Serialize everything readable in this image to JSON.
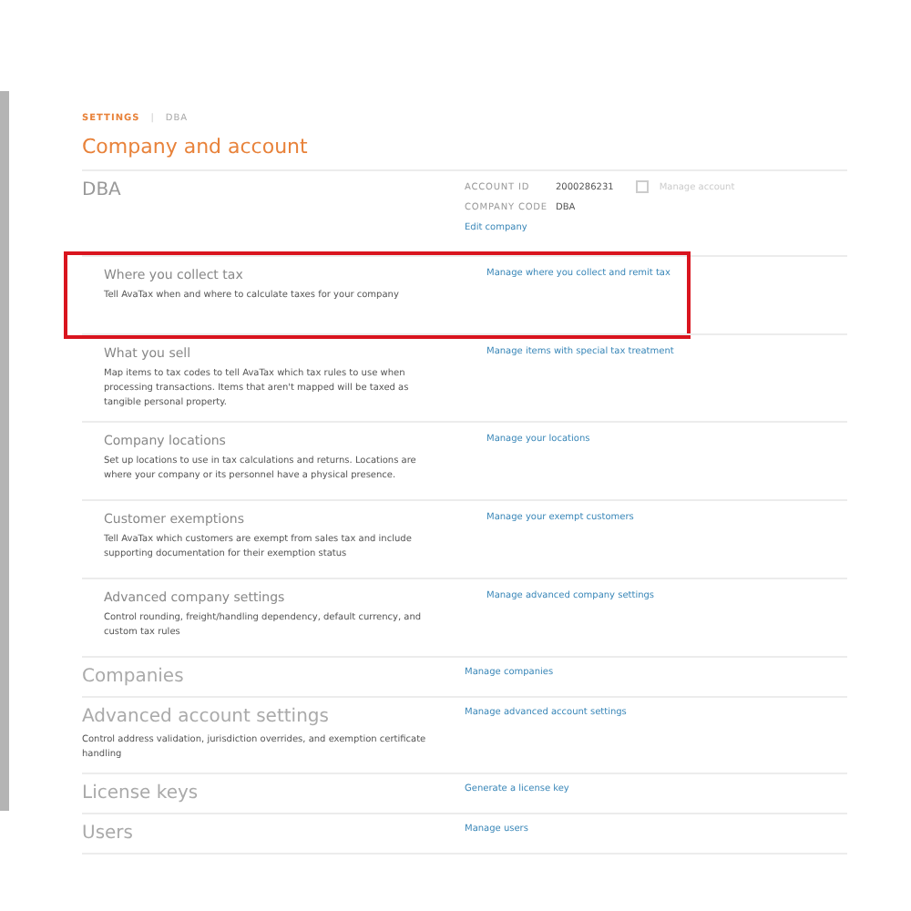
{
  "breadcrumb": {
    "root": "SETTINGS",
    "separator": "|",
    "current": "DBA"
  },
  "title": "Company and account",
  "company": {
    "name": "DBA",
    "account_id_label": "ACCOUNT ID",
    "account_id": "2000286231",
    "manage_account": {
      "label": "Manage account",
      "checked": false,
      "disabled": true
    },
    "company_code_label": "COMPANY CODE",
    "company_code": "DBA",
    "edit_link": "Edit company"
  },
  "company_items": [
    {
      "title": "Where you collect tax",
      "description": "Tell AvaTax when and where to calculate taxes for your company",
      "link": "Manage where you collect and remit tax",
      "highlighted": true
    },
    {
      "title": "What you sell",
      "description": "Map items to tax codes to tell AvaTax which tax rules to use when processing transactions. Items that aren't mapped will be taxed as tangible personal property.",
      "link": "Manage items with special tax treatment",
      "highlighted": false
    },
    {
      "title": "Company locations",
      "description": "Set up locations to use in tax calculations and returns. Locations are where your company or its personnel have a physical presence.",
      "link": "Manage your locations",
      "highlighted": false
    },
    {
      "title": "Customer exemptions",
      "description": "Tell AvaTax which customers are exempt from sales tax and include supporting documentation for their exemption status",
      "link": "Manage your exempt customers",
      "highlighted": false
    },
    {
      "title": "Advanced company settings",
      "description": "Control rounding, freight/handling dependency, default currency, and custom tax rules",
      "link": "Manage advanced company settings",
      "highlighted": false
    }
  ],
  "sections": [
    {
      "title": "Companies",
      "link": "Manage companies"
    },
    {
      "title": "Advanced account settings",
      "description": "Control address validation, jurisdiction overrides, and exemption certificate handling",
      "link": "Manage advanced account settings"
    },
    {
      "title": "License keys",
      "link": "Generate a license key"
    },
    {
      "title": "Users",
      "link": "Manage users"
    }
  ]
}
